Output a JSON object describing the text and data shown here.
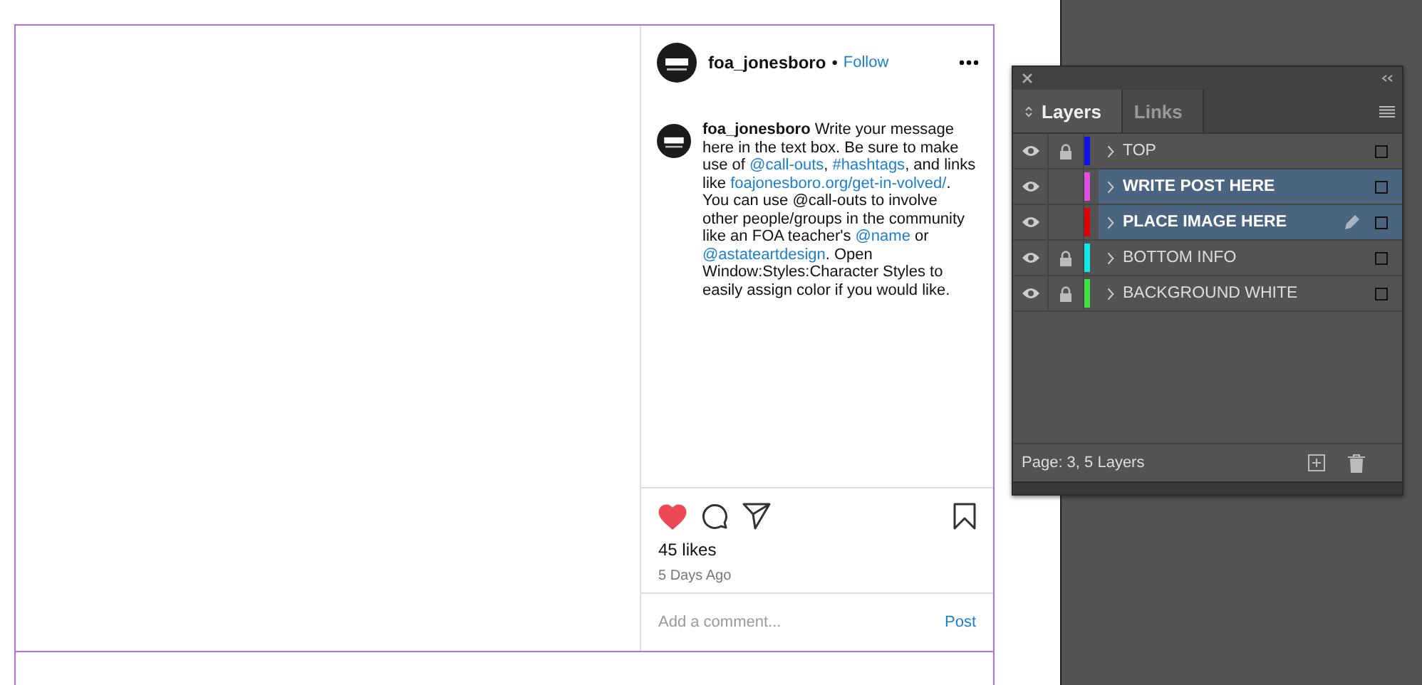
{
  "post": {
    "username": "foa_jonesboro",
    "separator": "•",
    "follow": "Follow",
    "caption": [
      {
        "kind": "user",
        "text": "foa_jonesboro"
      },
      {
        "kind": "text",
        "text": " Write your message here in the text box. Be sure to make use of "
      },
      {
        "kind": "link",
        "text": "@call-outs"
      },
      {
        "kind": "text",
        "text": ", "
      },
      {
        "kind": "link",
        "text": "#hashtags"
      },
      {
        "kind": "text",
        "text": ", and links like "
      },
      {
        "kind": "link",
        "text": "foajonesboro.org/get-in-volved/"
      },
      {
        "kind": "text",
        "text": ". You can use @call-outs to involve other people/groups in the community like an FOA teacher's "
      },
      {
        "kind": "link",
        "text": "@name"
      },
      {
        "kind": "text",
        "text": " or "
      },
      {
        "kind": "link",
        "text": "@astateartdesign"
      },
      {
        "kind": "text",
        "text": ". Open Window:Styles:Character Styles to easily assign color if you would like."
      }
    ],
    "liked": true,
    "likes": "45 likes",
    "time": "5 Days Ago",
    "comment_placeholder": "Add a comment...",
    "post_button": "Post"
  },
  "layers_panel": {
    "tabs": [
      {
        "label": "Layers",
        "selected": true
      },
      {
        "label": "Links",
        "selected": false
      }
    ],
    "layers": [
      {
        "name": "TOP",
        "visible": true,
        "locked": true,
        "color": "#1010e8",
        "selected": false,
        "target": false
      },
      {
        "name": "WRITE POST HERE",
        "visible": true,
        "locked": false,
        "color": "#e050e0",
        "selected": true,
        "target": false
      },
      {
        "name": "PLACE IMAGE HERE",
        "visible": true,
        "locked": false,
        "color": "#e00000",
        "selected": true,
        "target": true
      },
      {
        "name": "BOTTOM INFO",
        "visible": true,
        "locked": true,
        "color": "#10e8e8",
        "selected": false,
        "target": false
      },
      {
        "name": "BACKGROUND WHITE",
        "visible": true,
        "locked": true,
        "color": "#40e040",
        "selected": false,
        "target": false
      }
    ],
    "status": "Page: 3, 5 Layers"
  }
}
